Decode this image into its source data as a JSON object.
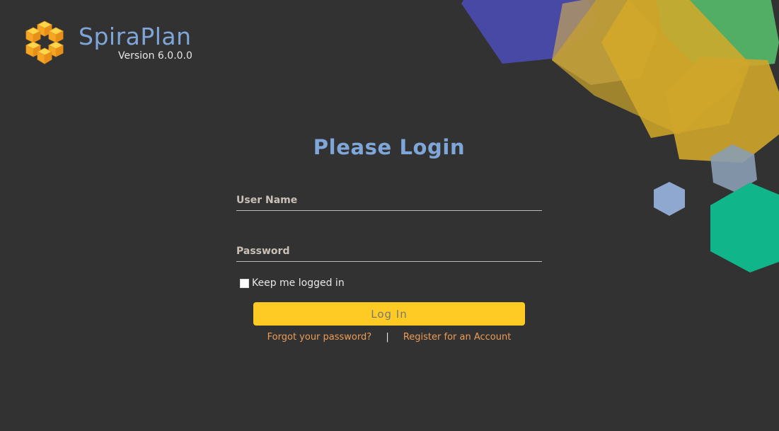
{
  "colors": {
    "background": "#323232",
    "brand_blue": "#7ea6d8",
    "button_yellow": "#fdcb24",
    "link_orange": "#ec9c56"
  },
  "brand": {
    "logo_icon": "cube-hexagon-logo",
    "app_name": "SpiraPlan",
    "version": "Version 6.0.0.0"
  },
  "login": {
    "title": "Please Login",
    "username_placeholder": "User Name",
    "password_placeholder": "Password",
    "remember_label": "Keep me logged in",
    "remember_checked": false,
    "login_button": "Log In",
    "forgot_password": "Forgot your password?",
    "separator": "|",
    "register": "Register for an Account"
  }
}
